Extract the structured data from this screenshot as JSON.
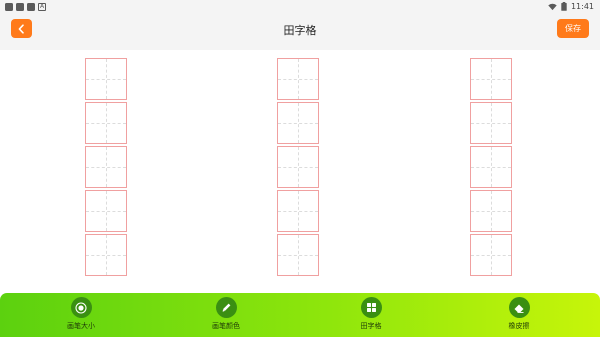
{
  "status_bar": {
    "time": "11:41",
    "icons": [
      "app-icon",
      "app-icon",
      "app-icon",
      "a-badge-icon",
      "wifi-icon",
      "battery-icon"
    ]
  },
  "header": {
    "title": "田字格",
    "save_label": "保存",
    "back_icon": "chevron-left-icon"
  },
  "grid": {
    "columns": 3,
    "rows_per_column": 5,
    "border_color": "#f0a0a0",
    "guide_color": "#dcdcdc"
  },
  "toolbar": {
    "items": [
      {
        "label": "画笔大小",
        "icon": "brush-size-icon"
      },
      {
        "label": "画笔颜色",
        "icon": "pencil-icon"
      },
      {
        "label": "田字格",
        "icon": "grid-icon"
      },
      {
        "label": "橡皮擦",
        "icon": "eraser-icon"
      }
    ],
    "gradient_start": "#5cd10f",
    "gradient_end": "#c7f50a",
    "icon_bg": "#3a8f12"
  },
  "colors": {
    "accent": "#ff7a1a",
    "header_bg": "#f4f4f4"
  }
}
